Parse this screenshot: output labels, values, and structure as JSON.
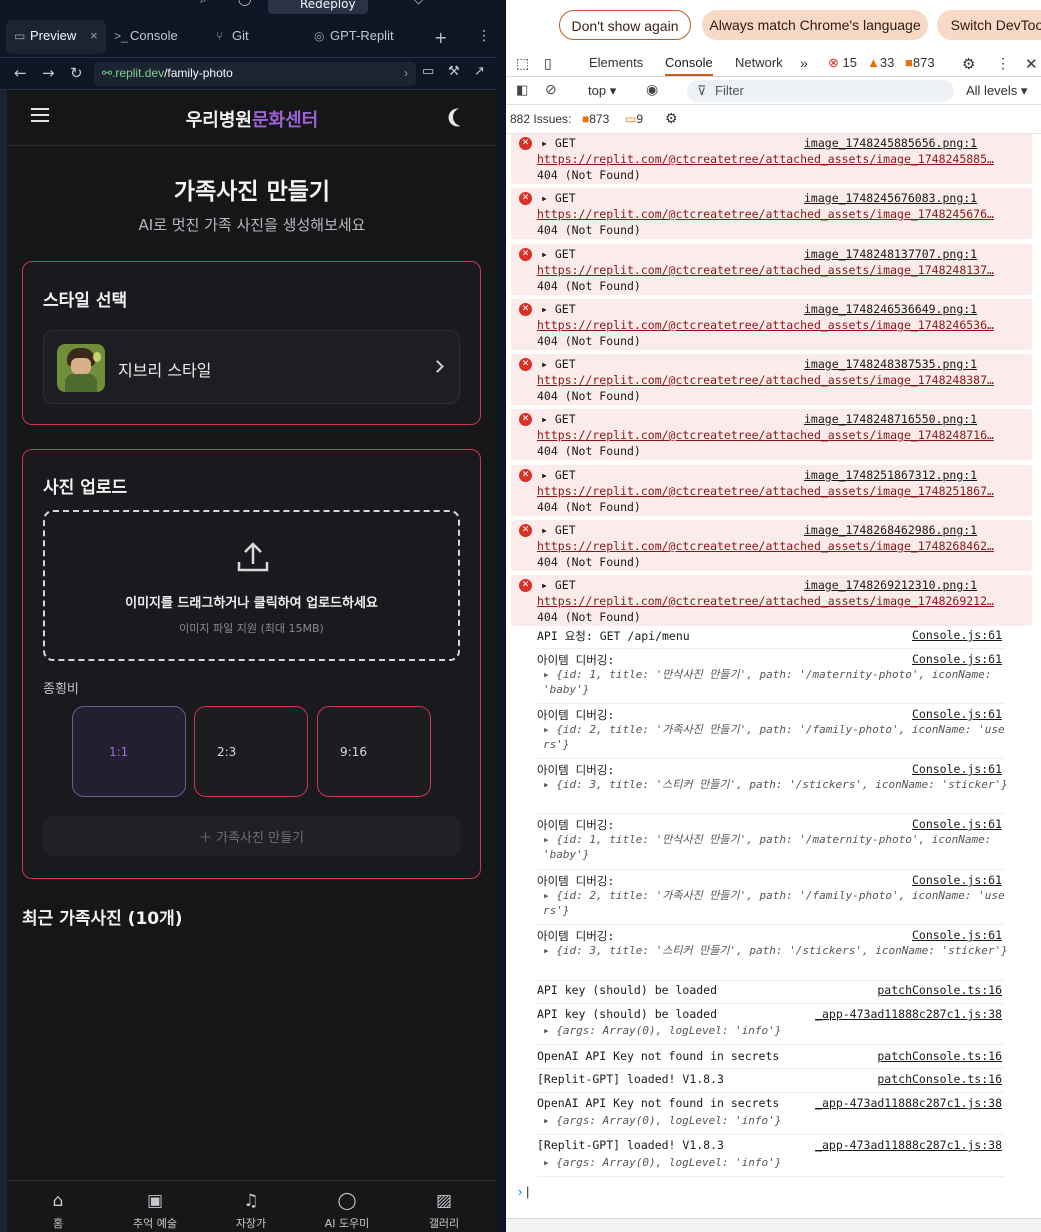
{
  "ide": {
    "redeploy": "Redeploy",
    "tabs": [
      {
        "label": "Preview",
        "icon": "monitor-icon"
      },
      {
        "label": "Console",
        "icon": "terminal-icon"
      },
      {
        "label": "Git",
        "icon": "git-icon"
      },
      {
        "label": "GPT-Replit",
        "icon": "openai-icon"
      }
    ],
    "url_domain": ".replit.dev",
    "url_path": "/family-photo"
  },
  "app": {
    "brand_main": "우리병원",
    "brand_accent": "문화센터",
    "page_title": "가족사진 만들기",
    "page_subtitle": "AI로 멋진 가족 사진을 생성해보세요",
    "style_section_title": "스타일 선택",
    "selected_style": "지브리 스타일",
    "upload_section_title": "사진 업로드",
    "upload_text": "이미지를 드래그하거나 클릭하여 업로드하세요",
    "upload_hint": "이미지 파일 지원 (최대 15MB)",
    "ratio_label": "종횡비",
    "ratios": [
      "1:1",
      "2:3",
      "9:16"
    ],
    "selected_ratio": "1:1",
    "create_button": "가족사진 만들기",
    "recent_title": "최근 가족사진 (10개)",
    "bottom_nav": [
      "홈",
      "추억 예술",
      "자장가",
      "AI 도우미",
      "갤러리"
    ]
  },
  "devtools": {
    "infobar": {
      "dont_show": "Don't show again",
      "always_match": "Always match Chrome's language",
      "switch": "Switch DevTools"
    },
    "tabs": [
      "Elements",
      "Console",
      "Network"
    ],
    "active_tab": "Console",
    "counts": {
      "errors": "15",
      "warnings": "33",
      "issues": "873"
    },
    "context": "top",
    "filter_placeholder": "Filter",
    "levels": "All levels",
    "issues_bar": {
      "label": "882 Issues:",
      "a": "873",
      "b": "9"
    },
    "errors": [
      {
        "src": "image_1748245885656.png:1",
        "url": "https://replit.com/@ctcreatetree/attached_assets/image_1748245885…",
        "status": "404 (Not Found)"
      },
      {
        "src": "image_1748245676083.png:1",
        "url": "https://replit.com/@ctcreatetree/attached_assets/image_1748245676…",
        "status": "404 (Not Found)"
      },
      {
        "src": "image_1748248137707.png:1",
        "url": "https://replit.com/@ctcreatetree/attached_assets/image_1748248137…",
        "status": "404 (Not Found)"
      },
      {
        "src": "image_1748246536649.png:1",
        "url": "https://replit.com/@ctcreatetree/attached_assets/image_1748246536…",
        "status": "404 (Not Found)"
      },
      {
        "src": "image_1748248387535.png:1",
        "url": "https://replit.com/@ctcreatetree/attached_assets/image_1748248387…",
        "status": "404 (Not Found)"
      },
      {
        "src": "image_1748248716550.png:1",
        "url": "https://replit.com/@ctcreatetree/attached_assets/image_1748248716…",
        "status": "404 (Not Found)"
      },
      {
        "src": "image_1748251867312.png:1",
        "url": "https://replit.com/@ctcreatetree/attached_assets/image_1748251867…",
        "status": "404 (Not Found)"
      },
      {
        "src": "image_1748268462986.png:1",
        "url": "https://replit.com/@ctcreatetree/attached_assets/image_1748268462…",
        "status": "404 (Not Found)"
      },
      {
        "src": "image_1748269212310.png:1",
        "url": "https://replit.com/@ctcreatetree/attached_assets/image_1748269212…",
        "status": "404 (Not Found)"
      }
    ],
    "get": "GET",
    "logs": {
      "api_req": "API 요청: GET /api/menu",
      "console_src": "Console.js:61",
      "item_debug": "아이템 디버깅:",
      "obj1": "{id: 1, title: '만삭사진 만들기', path: '/maternity-photo', iconName: 'baby'}",
      "obj2": "{id: 2, title: '가족사진 만들기', path: '/family-photo', iconName: 'users'}",
      "obj3": "{id: 3, title: '스티커 만들기', path: '/stickers', iconName: 'sticker'}",
      "api_key": "API key (should) be loaded",
      "patch_src": "patchConsole.ts:16",
      "app_src": "_app-473ad11888c287c1.js:38",
      "args_obj": "{args: Array(0), logLevel: 'info'}",
      "openai_missing": "OpenAI API Key not found in secrets",
      "gpt_loaded": "[Replit-GPT] loaded! V1.8.3"
    }
  }
}
